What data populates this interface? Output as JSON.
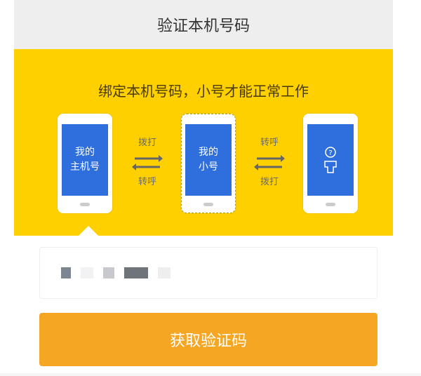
{
  "header": {
    "title": "验证本机号码"
  },
  "banner": {
    "title": "绑定本机号码，小号才能正常工作",
    "phones": [
      {
        "label_line1": "我的",
        "label_line2": "主机号"
      },
      {
        "label_line1": "我的",
        "label_line2": "小号"
      },
      {
        "icon": "question-person-icon"
      }
    ],
    "arrows": [
      {
        "top_label": "拨打",
        "bottom_label": "转呼"
      },
      {
        "top_label": "转呼",
        "bottom_label": "拨打"
      }
    ]
  },
  "phone_input": {
    "masked_value": "■ ■ ■■"
  },
  "submit": {
    "label": "获取验证码"
  },
  "colors": {
    "banner": "#ffd000",
    "screen": "#2f6fdd",
    "button": "#f5a623",
    "header_bg": "#eeeeee"
  }
}
